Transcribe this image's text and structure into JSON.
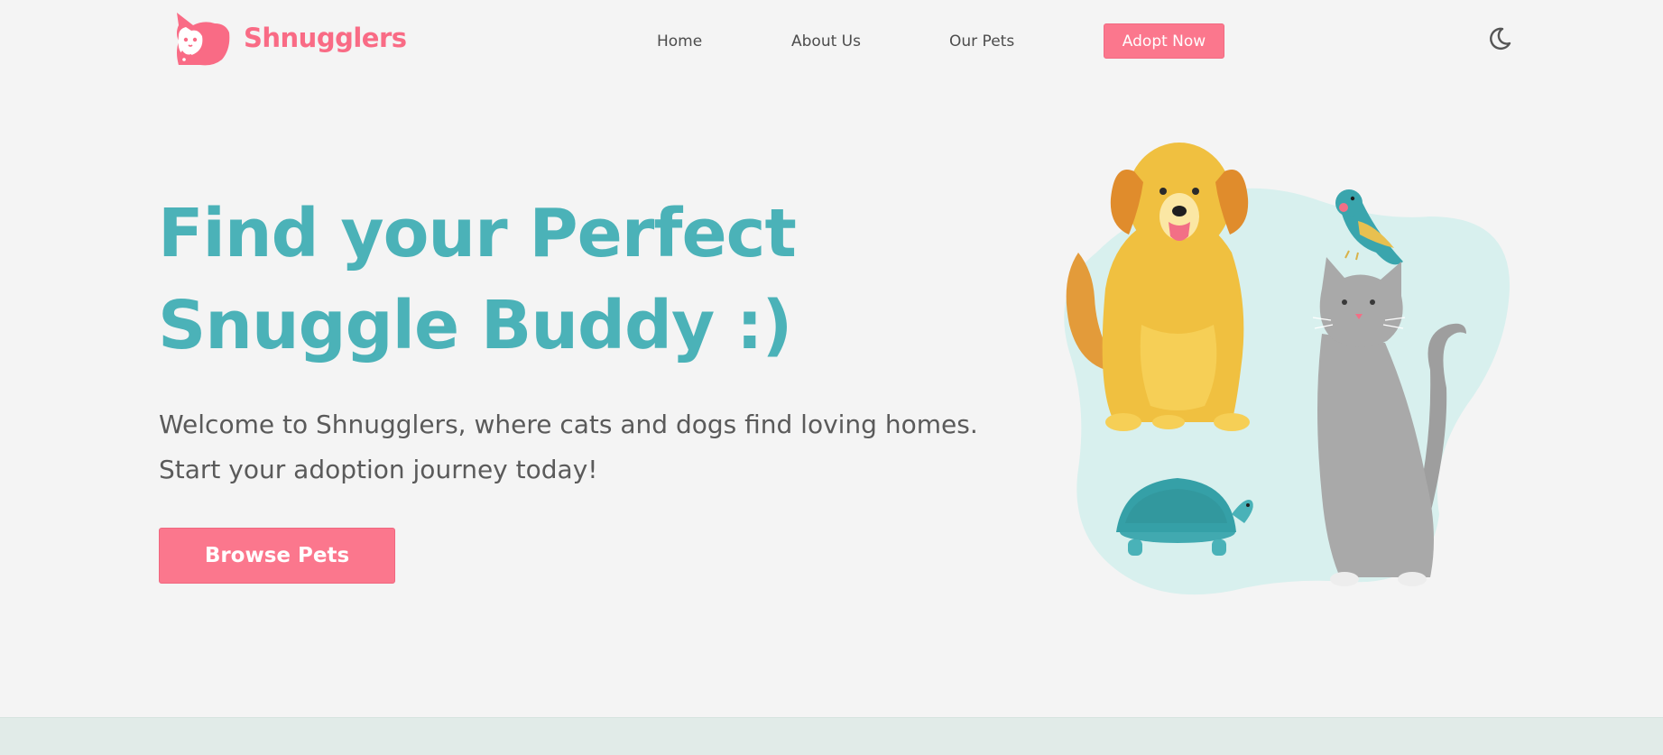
{
  "brand": {
    "name": "Shnugglers",
    "logo_icon": "cat-dog-logo-icon",
    "color": "#f96b85"
  },
  "nav": {
    "items": [
      {
        "label": "Home"
      },
      {
        "label": "About Us"
      },
      {
        "label": "Our Pets"
      }
    ],
    "cta_label": "Adopt Now",
    "theme_toggle_icon": "moon-icon"
  },
  "hero": {
    "title_line1": "Find your Perfect",
    "title_line2": "Snuggle Buddy :)",
    "text_line1": "Welcome to Shnugglers, where cats and dogs find loving homes.",
    "text_line2": "Start your adoption journey today!",
    "button_label": "Browse Pets",
    "illustration": "pets-illustration"
  },
  "colors": {
    "accent": "#fb778d",
    "title": "#4bb2b8",
    "background": "#f4f4f4",
    "blob": "#d8f0ee"
  }
}
